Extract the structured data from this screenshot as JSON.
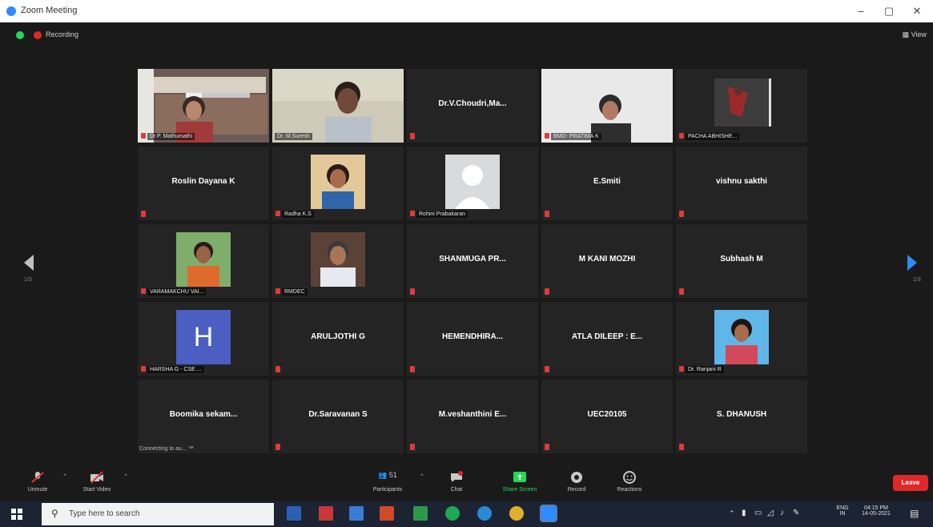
{
  "window": {
    "title": "Zoom Meeting",
    "min": "–",
    "max": "▢",
    "close": "✕"
  },
  "topbar": {
    "recording": "Recording",
    "view": "View",
    "view_icon": "grid-icon"
  },
  "colors": {
    "accent": "#2d8cff",
    "mute": "#e03a3a",
    "active_speaker": "#b5e048",
    "leave": "#e02828",
    "tile_bg": "#242424"
  },
  "pagination": {
    "left": "1/3",
    "right": "1/3"
  },
  "tiles": [
    {
      "type": "video",
      "label": "Dr.P. Mathumathi",
      "active": false
    },
    {
      "type": "video",
      "label": "Dr. M.Suresh",
      "active": true
    },
    {
      "type": "name",
      "name": "Dr.V.Choudri,Ma...",
      "label": "",
      "active": false
    },
    {
      "type": "video",
      "label": "BMD- PRATIMA K",
      "active": false
    },
    {
      "type": "video",
      "label": "PACHA ABHISHE...",
      "active": false
    },
    {
      "type": "name",
      "name": "Roslin Dayana K",
      "label": ""
    },
    {
      "type": "photo",
      "label": "Radha K.S"
    },
    {
      "type": "photo",
      "label": "Rohini Prabakaran"
    },
    {
      "type": "name",
      "name": "E.Smiti",
      "label": ""
    },
    {
      "type": "name",
      "name": "vishnu sakthi",
      "label": ""
    },
    {
      "type": "photo",
      "label": "VARAMAKCHU VAI..."
    },
    {
      "type": "photo",
      "label": "RMDEC"
    },
    {
      "type": "name",
      "name": "SHANMUGA PR...",
      "label": ""
    },
    {
      "type": "name",
      "name": "M KANI MOZHI",
      "label": ""
    },
    {
      "type": "name",
      "name": "Subhash M",
      "label": ""
    },
    {
      "type": "letter",
      "letter": "H",
      "label": "HARSHA G - CSE ..."
    },
    {
      "type": "name",
      "name": "ARULJOTHI G",
      "label": ""
    },
    {
      "type": "name",
      "name": "HEMENDHIRA...",
      "label": ""
    },
    {
      "type": "name",
      "name": "ATLA DILEEP : E...",
      "label": ""
    },
    {
      "type": "photo",
      "label": "Dr. Ranjani R"
    },
    {
      "type": "name",
      "name": "Boomika sekam...",
      "label": "",
      "status": "Connecting to au... ™"
    },
    {
      "type": "name",
      "name": "Dr.Saravanan S",
      "label": ""
    },
    {
      "type": "name",
      "name": "M.veshanthini E...",
      "label": ""
    },
    {
      "type": "name",
      "name": "UEC20105",
      "label": ""
    },
    {
      "type": "name",
      "name": "S. DHANUSH",
      "label": ""
    }
  ],
  "toolbar": {
    "unmute": "Unmute",
    "start_video": "Start Video",
    "participants": "Participants",
    "participants_count": "51",
    "chat": "Chat",
    "share_screen": "Share Screen",
    "record": "Record",
    "reactions": "Reactions",
    "leave": "Leave"
  },
  "taskbar": {
    "search_placeholder": "Type here to search",
    "lang": "ENG",
    "region": "IN",
    "time": "04:15 PM",
    "date": "14-05-2021"
  }
}
